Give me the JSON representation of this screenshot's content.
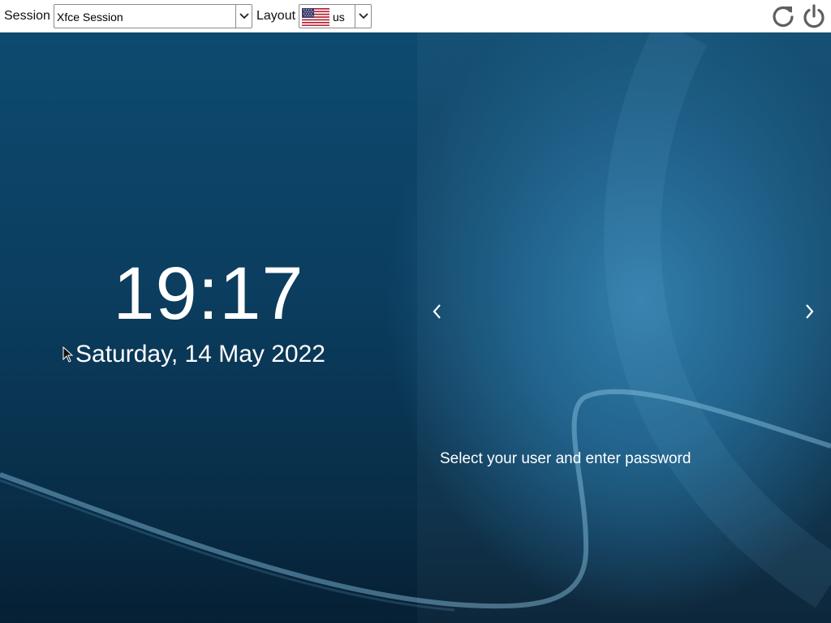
{
  "topbar": {
    "session_label": "Session",
    "session_value": "Xfce Session",
    "layout_label": "Layout",
    "layout_value": "us",
    "layout_flag_icon": "us-flag-icon",
    "restart_icon": "restart-icon",
    "shutdown_icon": "power-icon"
  },
  "greeter": {
    "time": "19:17",
    "date": "Saturday, 14 May 2022",
    "prompt": "Select your user and enter password",
    "prev_icon": "chevron-left-icon",
    "next_icon": "chevron-right-icon"
  },
  "colors": {
    "background_top": "#0d4a70",
    "background_bottom": "#061f33",
    "text": "#ffffff"
  }
}
